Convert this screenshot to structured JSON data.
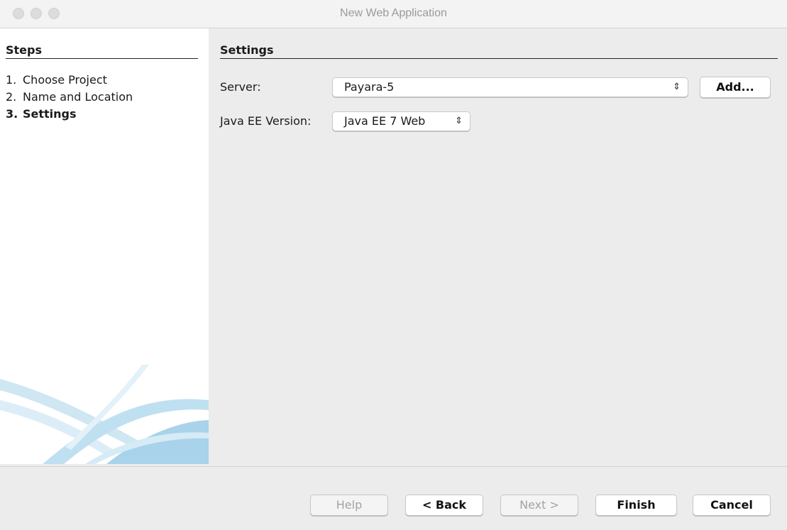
{
  "window": {
    "title": "New Web Application"
  },
  "steps": {
    "title": "Steps",
    "items": [
      {
        "num": "1.",
        "label": "Choose Project"
      },
      {
        "num": "2.",
        "label": "Name and Location"
      },
      {
        "num": "3.",
        "label": "Settings"
      }
    ]
  },
  "settings": {
    "title": "Settings",
    "server_label": "Server:",
    "server_value": "Payara-5",
    "add_label": "Add...",
    "javaee_label": "Java EE Version:",
    "javaee_value": "Java EE 7 Web"
  },
  "buttons": {
    "help": "Help",
    "back": "< Back",
    "next": "Next >",
    "finish": "Finish",
    "cancel": "Cancel"
  },
  "icons": {
    "select_chevron": "up-down-chevron-icon",
    "window_controls": [
      "close-icon",
      "minimize-icon",
      "zoom-icon"
    ]
  },
  "colors": {
    "window_bg": "#ececec",
    "sidebar_bg": "#ffffff",
    "disabled_text": "#a3a3a3",
    "swoosh": "#a8d3ea"
  }
}
